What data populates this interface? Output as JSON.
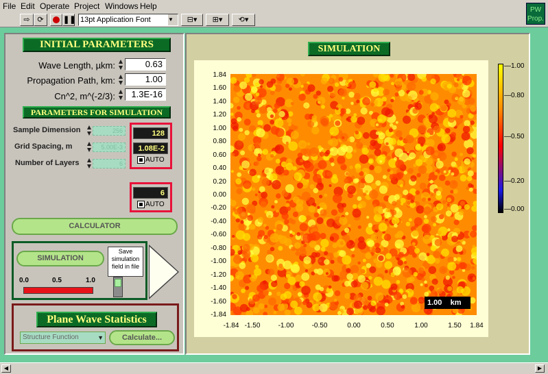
{
  "menu": {
    "file": "File",
    "edit": "Edit",
    "operate": "Operate",
    "project": "Project",
    "windows": "Windows",
    "help": "Help"
  },
  "toolbar": {
    "font_select": "13pt Application Font",
    "pw_prop_line1": "PW",
    "pw_prop_line2": "Prop."
  },
  "initial_params": {
    "title": "INITIAL PARAMETERS",
    "wave_length_label": "Wave Length, µkm:",
    "wave_length_value": "0.63",
    "propagation_label": "Propagation Path, km:",
    "propagation_value": "1.00",
    "cn2_label": "Cn^2, m^(-2/3):",
    "cn2_value": "1.3E-16"
  },
  "sim_params": {
    "title": "PARAMETERS FOR SIMULATION",
    "sample_dim_label": "Sample Dimension",
    "sample_dim_ghost": "256",
    "sample_dim_value": "128",
    "grid_spacing_label": "Grid Spacing, m",
    "grid_spacing_ghost": "5.00E-3",
    "grid_spacing_value": "1.08E-2",
    "layers_label": "Number of Layers",
    "layers_ghost": "6",
    "layers_value": "6",
    "auto_label": "AUTO",
    "auto_label2": "AUTO"
  },
  "calculator_button": "CALCULATOR",
  "simulation_panel": {
    "simulation_button": "SIMULATION",
    "progress_ticks": [
      "0.0",
      "0.5",
      "1.0"
    ],
    "progress_value": 1.0,
    "save_label": "Save simulation field in file"
  },
  "stats": {
    "title": "Plane Wave Statistics",
    "select_value": "Structure Function",
    "calculate_button": "Calculate..."
  },
  "plot": {
    "title": "SIMULATION",
    "y_ticks": [
      "1.84",
      "1.60",
      "1.40",
      "1.20",
      "1.00",
      "0.80",
      "0.60",
      "0.40",
      "0.20",
      "0.00",
      "-0.20",
      "-0.40",
      "-0.60",
      "-0.80",
      "-1.00",
      "-1.20",
      "-1.40",
      "-1.60",
      "-1.84"
    ],
    "x_ticks": [
      "-1.84",
      "-1.50",
      "-1.00",
      "-0.50",
      "0.00",
      "0.50",
      "1.00",
      "1.50",
      "1.84"
    ],
    "scale_bar": "1.00    km",
    "colorbar_ticks": [
      "1.00",
      "0.80",
      "0.50",
      "0.20",
      "0.00"
    ],
    "colors": {
      "low": "#000000",
      "mid_low": "#1a1ae6",
      "mid": "#ff0000",
      "mid_high": "#ff8000",
      "high": "#ffff00"
    }
  }
}
